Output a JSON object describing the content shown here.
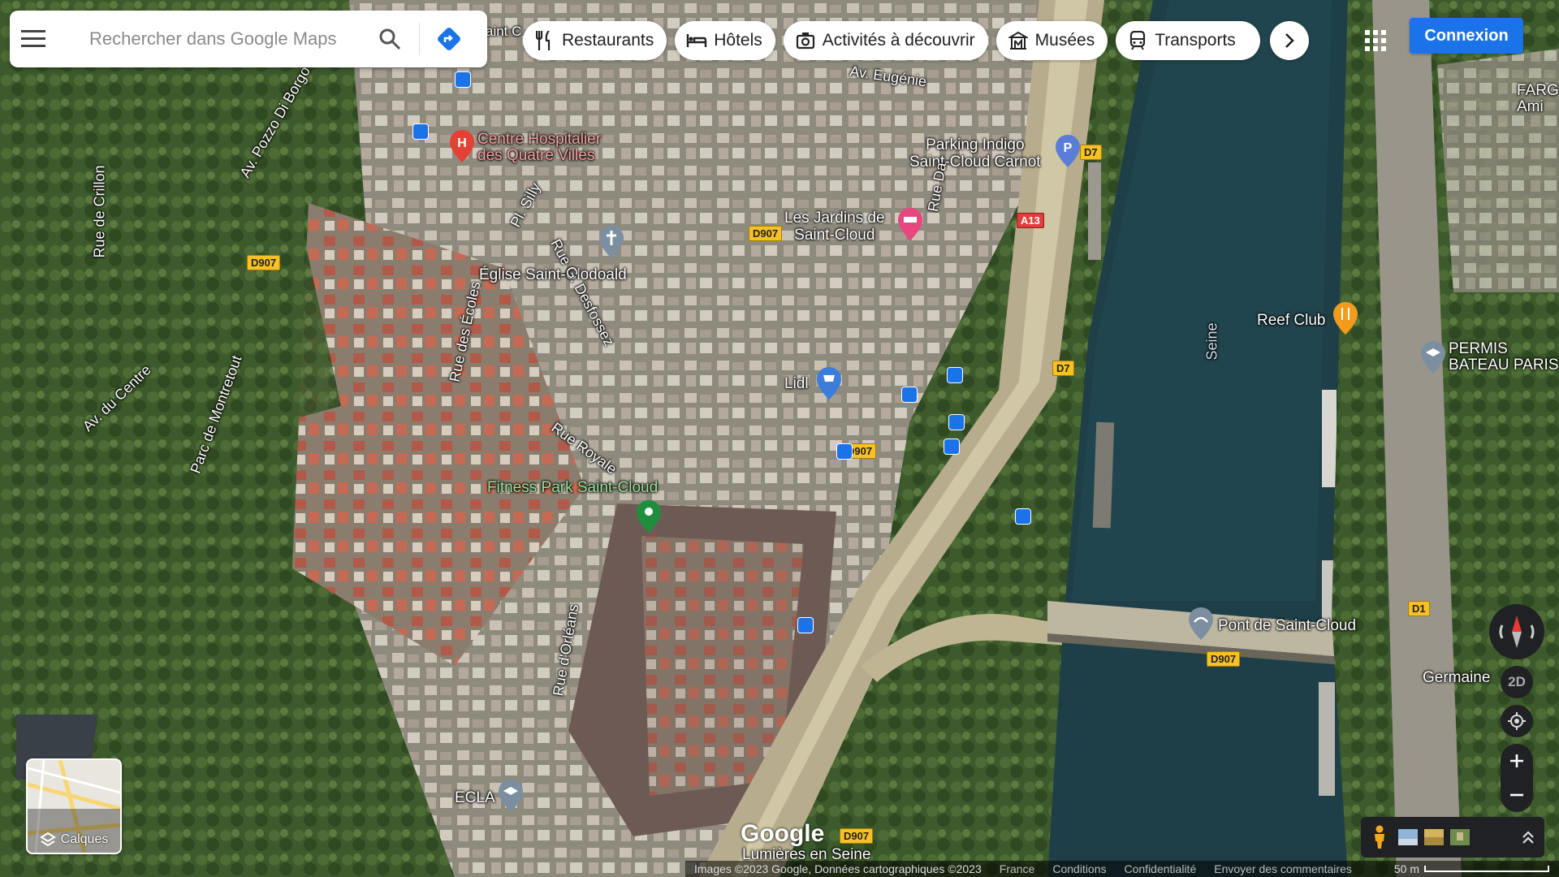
{
  "search": {
    "placeholder": "Rechercher dans Google Maps"
  },
  "chips": [
    {
      "label": "Restaurants",
      "icon": "fork-knife-icon"
    },
    {
      "label": "Hôtels",
      "icon": "bed-icon"
    },
    {
      "label": "Activités à découvrir",
      "icon": "camera-icon"
    },
    {
      "label": "Musées",
      "icon": "museum-icon"
    },
    {
      "label": "Transports",
      "icon": "train-icon"
    }
  ],
  "login_label": "Connexion",
  "layers_label": "Calques",
  "btn_2d": "2D",
  "places": {
    "hospital": "Centre Hospitalier\ndes Quatre Villes",
    "church": "Église Saint-Clodoald",
    "jardins": "Les Jardins de\nSaint-Cloud",
    "parking": "Parking Indigo\nSaint-Cloud Carnot",
    "lidl": "Lidl",
    "fitness": "Fitness Park Saint-Cloud",
    "reef": "Reef Club",
    "permis": "PERMIS\nBATEAU PARIS",
    "pont": "Pont de Saint-Cloud",
    "germaine": "Germaine",
    "ecla": "ECLA",
    "lumieres": "Lumières en Seine",
    "farg": "FARG\nAmi",
    "saint_top": "aint C"
  },
  "roads": {
    "eugenie": "Av. Eugénie",
    "pozzo": "Av. Pozzo Di Borgo",
    "crillon": "Rue de Crillon",
    "silly": "Pl. Silly",
    "desfossez": "Rue G. Desfossez",
    "ecoles": "Rue des Écoles",
    "royale": "Rue Royale",
    "centre": "Av. du Centre",
    "montretout": "Parc de Montretout",
    "orleans": "Rue d'Orléans",
    "dailly": "Rue Da",
    "seine": "Seine"
  },
  "shields": {
    "d907": "D907",
    "d7": "D7",
    "a13": "A13",
    "d1": "D1"
  },
  "footer": {
    "copyright": "Images ©2023 Google, Données cartographiques ©2023",
    "france": "France",
    "conditions": "Conditions",
    "privacy": "Confidentialité",
    "feedback": "Envoyer des commentaires",
    "scale": "50 m"
  },
  "logo": "Google",
  "colors": {
    "accent": "#1a73e8",
    "river": "#1f3f48",
    "controls": "#202124"
  }
}
